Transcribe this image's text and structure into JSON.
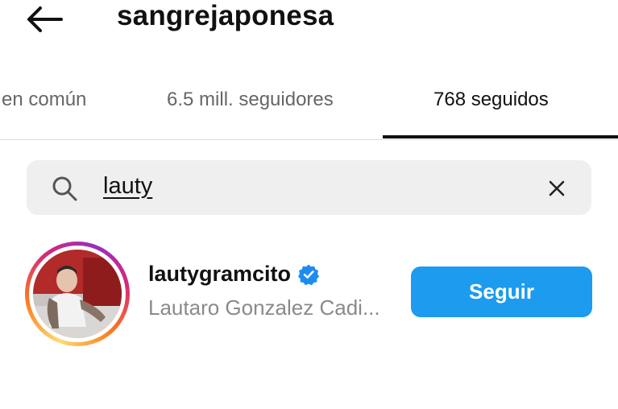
{
  "header": {
    "title": "sangrejaponesa",
    "back_icon": "arrow-left-icon"
  },
  "tabs": [
    {
      "label": "en común",
      "active": false
    },
    {
      "label": "6.5 mill. seguidores",
      "active": false
    },
    {
      "label": "768 seguidos",
      "active": true
    }
  ],
  "search": {
    "value": "lauty",
    "search_icon": "search-icon",
    "clear_icon": "close-icon"
  },
  "results": [
    {
      "username": "lautygramcito",
      "verified": true,
      "full_name": "Lautaro Gonzalez Cadi...",
      "follow_label": "Seguir"
    }
  ],
  "colors": {
    "accent": "#1c9bef",
    "verified": "#1d8cf0",
    "secondary_text": "#8a8a8a",
    "search_bg": "#efefef"
  }
}
